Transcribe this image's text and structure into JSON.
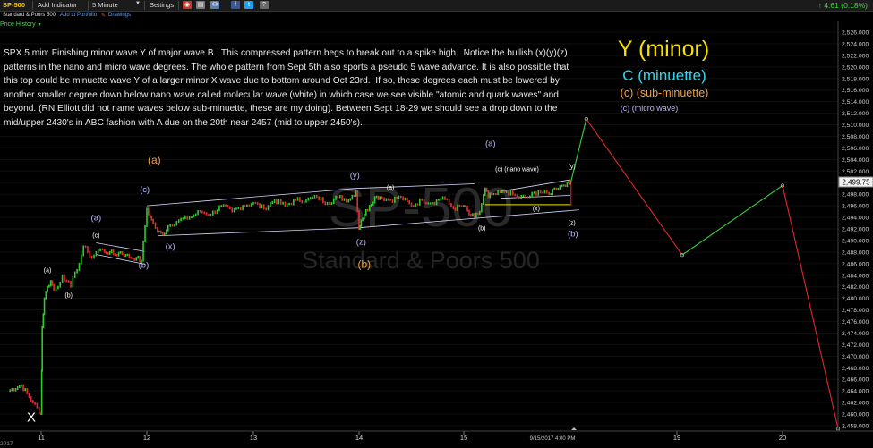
{
  "toolbar": {
    "symbol": "SP-500",
    "add_indicator": "Add Indicator",
    "interval": "5 Minute",
    "settings": "Settings",
    "change": "4.61 (0.18%)"
  },
  "subbar": {
    "name": "Standard & Poors 500",
    "add_portfolio": "Add to Portfolio",
    "drawings": "Drawings"
  },
  "price_history_label": "Price History",
  "description": "SPX 5 min: Finishing minor wave Y of major wave B.  This compressed pattern begs to break out to a spike high.  Notice the bullish (x)(y)(z) patterns in the nano and micro wave degrees. The whole pattern from Sept 5th also sports a pseudo 5 wave advance. It is also possible that this top could be minuette wave Y of a larger minor X wave due to bottom around Oct 23rd.  If so, these degrees each must be lowered by another smaller degree down below nano wave called molecular wave (white) in which case we see visible \"atomic and quark waves\" and beyond. (RN Elliott did not name waves below sub-minuette, these are my doing). Between Sept 18-29 we should see a drop down to the mid/upper 2430's in ABC fashion with A due on the 20th near 2457 (mid to upper 2450's).",
  "legend": {
    "minor": "Y (minor)",
    "minuette": "C (minuette)",
    "subminuette": "(c) (sub-minuette)",
    "micro": "(c) (micro wave)"
  },
  "watermark": {
    "big": "SP-500",
    "small": "Standard & Poors 500"
  },
  "last_price": "2,499.75",
  "timestamp_label": "9/15/2017 4:00 PM",
  "year_label": "2017",
  "colors": {
    "background": "#000000",
    "candle_up": "#2ecc2e",
    "candle_down": "#e03030",
    "forecast_up": "#3ad03a",
    "forecast_down": "#e02828",
    "channel": "#d8d8ff",
    "yellow_line": "#f0e000",
    "minor": "#f5e000",
    "minuette": "#2fd8f0",
    "subminuette": "#f0a040",
    "micro": "#b8b8ff",
    "nano": "#ffffff"
  },
  "chart_data": {
    "type": "line",
    "title": "SP-500 5 Minute",
    "x_ticks": [
      "11",
      "12",
      "13",
      "14",
      "15",
      "19",
      "20"
    ],
    "y_ticks": [
      2458,
      2460,
      2462,
      2464,
      2466,
      2468,
      2470,
      2472,
      2474,
      2476,
      2478,
      2480,
      2482,
      2484,
      2486,
      2488,
      2490,
      2492,
      2494,
      2496,
      2498,
      2500,
      2502,
      2504,
      2506,
      2508,
      2510,
      2512,
      2514,
      2516,
      2518,
      2520,
      2522,
      2524,
      2526
    ],
    "ylim": [
      2457.5,
      2527
    ],
    "series": [
      {
        "style": "price",
        "x": [
          10.8,
          10.88,
          10.95,
          11.0,
          11.01,
          11.03,
          11.06,
          11.09,
          11.12,
          11.16,
          11.2,
          11.24,
          11.28,
          11.32,
          11.36,
          11.4,
          11.44,
          11.48,
          11.52,
          11.56,
          11.6,
          11.65,
          11.7,
          11.75,
          11.8,
          11.85,
          11.9,
          11.95,
          12.0,
          12.03,
          12.06,
          12.1,
          12.15,
          12.2,
          12.3,
          12.4,
          12.5,
          12.6,
          12.7,
          12.8,
          12.9,
          13.0,
          13.1,
          13.2,
          13.3,
          13.4,
          13.5,
          13.6,
          13.7,
          13.8,
          13.9,
          13.97,
          14.0,
          14.02,
          14.05,
          14.1,
          14.15,
          14.2,
          14.3,
          14.4,
          14.5,
          14.6,
          14.7,
          14.8,
          14.9,
          15.0,
          15.05,
          15.1,
          15.15,
          15.2,
          15.23,
          15.26,
          15.3,
          15.4,
          15.5,
          15.6,
          15.7,
          15.8,
          15.85,
          15.92,
          15.97,
          16.0
        ],
        "y": [
          2464,
          2465,
          2462,
          2460,
          2475,
          2480,
          2482,
          2483,
          2481.5,
          2482,
          2484,
          2483,
          2482,
          2484.5,
          2486,
          2489,
          2488,
          2487,
          2488,
          2488.5,
          2488,
          2488,
          2487.5,
          2488,
          2487.5,
          2487,
          2487,
          2486.5,
          2495.5,
          2494,
          2493,
          2491.5,
          2491,
          2492.5,
          2493.5,
          2494,
          2495,
          2494.5,
          2496,
          2495,
          2496,
          2496.5,
          2495.5,
          2497,
          2496,
          2497,
          2497,
          2497.5,
          2496.5,
          2497.5,
          2497,
          2498.5,
          2492,
          2493.5,
          2494.5,
          2496,
          2497.5,
          2497.5,
          2497,
          2497.5,
          2496,
          2497,
          2496.5,
          2497.5,
          2495.5,
          2496,
          2494.5,
          2494,
          2495,
          2499,
          2497.5,
          2498,
          2498,
          2498.5,
          2497.5,
          2497.5,
          2498.5,
          2498,
          2499,
          2499.5,
          2500,
          2499.75
        ]
      },
      {
        "style": "forecast_up",
        "x": [
          16.0,
          16.45
        ],
        "y": [
          2499.75,
          2511
        ]
      },
      {
        "style": "forecast_down",
        "x": [
          16.45,
          19.05
        ],
        "y": [
          2511,
          2487.5
        ]
      },
      {
        "style": "forecast_up",
        "x": [
          19.05,
          20.0
        ],
        "y": [
          2487.5,
          2499.5
        ]
      },
      {
        "style": "forecast_down",
        "x": [
          20.0,
          20.55
        ],
        "y": [
          2499.5,
          2457.5
        ]
      }
    ]
  },
  "wave_labels": [
    {
      "text": "X",
      "x": 10.94,
      "y": 2458.7,
      "color": "nano",
      "size": 15
    },
    {
      "text": "(a)",
      "x": 11.06,
      "y": 2484.5,
      "color": "nano",
      "size": 7
    },
    {
      "text": "(b)",
      "x": 11.26,
      "y": 2480.2,
      "color": "nano",
      "size": 7
    },
    {
      "text": "(c)",
      "x": 11.52,
      "y": 2490.5,
      "color": "nano",
      "size": 7
    },
    {
      "text": "(a)",
      "x": 11.52,
      "y": 2493.5,
      "color": "micro",
      "size": 9.5
    },
    {
      "text": "(b)",
      "x": 11.97,
      "y": 2485.3,
      "color": "micro",
      "size": 9.5
    },
    {
      "text": "(c)",
      "x": 11.98,
      "y": 2498.3,
      "color": "micro",
      "size": 9.5
    },
    {
      "text": "(a)",
      "x": 12.07,
      "y": 2503.3,
      "color": "subminuette",
      "size": 12
    },
    {
      "text": "(x)",
      "x": 12.22,
      "y": 2488.5,
      "color": "micro",
      "size": 9.5
    },
    {
      "text": "(y)",
      "x": 13.96,
      "y": 2500.8,
      "color": "micro",
      "size": 9.5
    },
    {
      "text": "(z)",
      "x": 14.02,
      "y": 2489.3,
      "color": "micro",
      "size": 9.5
    },
    {
      "text": "(b)",
      "x": 14.05,
      "y": 2485.3,
      "color": "subminuette",
      "size": 12
    },
    {
      "text": "(a)",
      "x": 14.3,
      "y": 2498.8,
      "color": "nano",
      "size": 7
    },
    {
      "text": "(a)",
      "x": 15.25,
      "y": 2506.3,
      "color": "micro",
      "size": 9.5
    },
    {
      "text": "(c) (nano wave)",
      "x": 15.5,
      "y": 2502.0,
      "color": "nano",
      "size": 7
    },
    {
      "text": "(y)",
      "x": 16.04,
      "y": 2502.4,
      "color": "nano",
      "size": 7
    },
    {
      "text": "(x)",
      "x": 15.68,
      "y": 2495.2,
      "color": "nano",
      "size": 7
    },
    {
      "text": "(b)",
      "x": 15.17,
      "y": 2491.8,
      "color": "nano",
      "size": 7
    },
    {
      "text": "(z)",
      "x": 16.04,
      "y": 2492.7,
      "color": "nano",
      "size": 7
    },
    {
      "text": "(b)",
      "x": 16.07,
      "y": 2490.7,
      "color": "micro",
      "size": 9.5
    }
  ]
}
